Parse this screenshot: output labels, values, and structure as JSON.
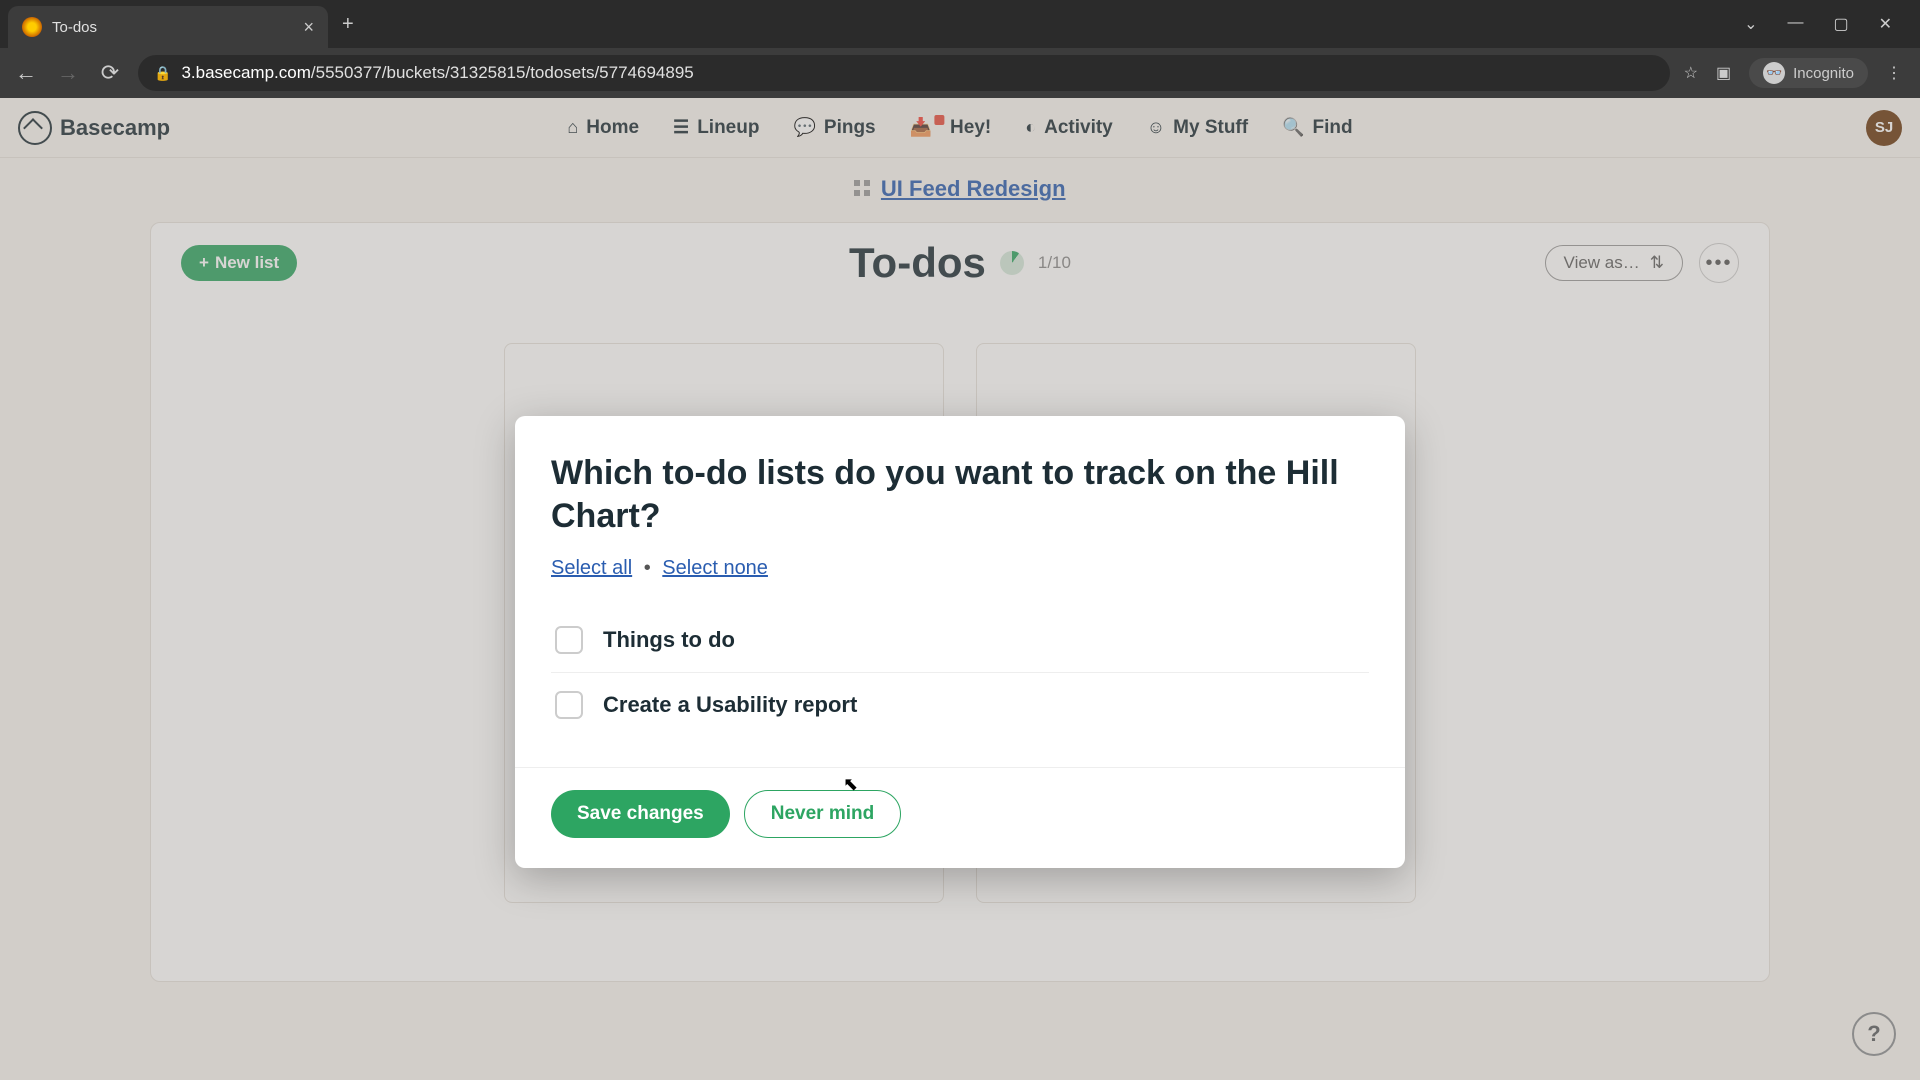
{
  "browser": {
    "tab_title": "To-dos",
    "url_domain": "3.basecamp.com",
    "url_path": "/5550377/buckets/31325815/todosets/5774694895",
    "incognito_label": "Incognito"
  },
  "app": {
    "brand": "Basecamp",
    "nav": {
      "home": "Home",
      "lineup": "Lineup",
      "pings": "Pings",
      "hey": "Hey!",
      "activity": "Activity",
      "mystuff": "My Stuff",
      "find": "Find"
    },
    "avatar_initials": "SJ",
    "project_name": "UI Feed Redesign",
    "page_title": "To-dos",
    "completed_count": "1/10",
    "new_list_label": "New list",
    "view_as_label": "View as…"
  },
  "modal": {
    "heading": "Which to-do lists do you want to track on the Hill Chart?",
    "select_all": "Select all",
    "select_none": "Select none",
    "separator": "•",
    "items": [
      "Things to do",
      "Create a Usability report"
    ],
    "save_label": "Save changes",
    "cancel_label": "Never mind"
  },
  "help_label": "?"
}
